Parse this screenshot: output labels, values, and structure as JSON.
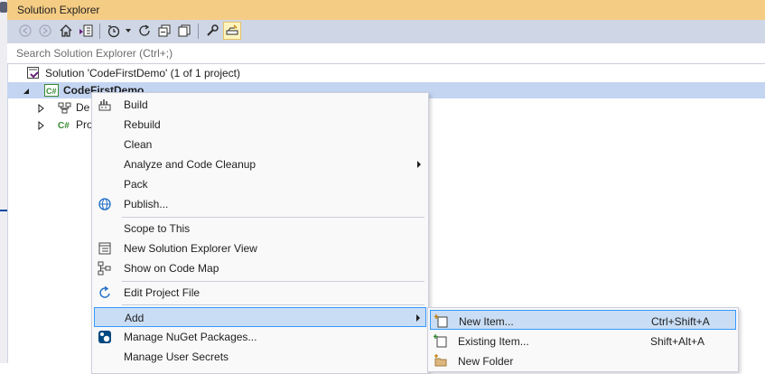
{
  "window": {
    "title": "Solution Explorer"
  },
  "toolbar": {
    "buttons": [
      "back-icon",
      "forward-icon",
      "home-icon",
      "vs-switch-views-icon",
      "pending-changes-filter-icon",
      "dropdown-arrow-icon",
      "refresh-icon",
      "collapse-all-icon",
      "show-all-files-icon",
      "properties-wrench-icon",
      "preview-selected-items-icon"
    ]
  },
  "search": {
    "placeholder": "Search Solution Explorer (Ctrl+;)"
  },
  "tree": {
    "solution": "Solution 'CodeFirstDemo' (1 of 1 project)",
    "project": "CodeFirstDemo",
    "children": [
      "De",
      "Pro"
    ]
  },
  "context_menu": {
    "items": [
      {
        "label": "Build",
        "icon": "build-icon"
      },
      {
        "label": "Rebuild"
      },
      {
        "label": "Clean"
      },
      {
        "label": "Analyze and Code Cleanup",
        "submenu": true
      },
      {
        "label": "Pack"
      },
      {
        "label": "Publish...",
        "icon": "publish-globe-icon"
      },
      {
        "label": "Scope to This"
      },
      {
        "label": "New Solution Explorer View",
        "icon": "new-explorer-view-icon"
      },
      {
        "label": "Show on Code Map",
        "icon": "code-map-icon"
      },
      {
        "label": "Edit Project File",
        "icon": "edit-project-icon"
      },
      {
        "label": "Add",
        "submenu": true,
        "highlighted": true
      },
      {
        "label": "Manage NuGet Packages...",
        "icon": "nuget-icon"
      },
      {
        "label": "Manage User Secrets"
      }
    ]
  },
  "add_submenu": {
    "items": [
      {
        "label": "New Item...",
        "shortcut": "Ctrl+Shift+A",
        "icon": "new-item-icon",
        "highlighted": true
      },
      {
        "label": "Existing Item...",
        "shortcut": "Shift+Alt+A",
        "icon": "existing-item-icon"
      },
      {
        "label": "New Folder",
        "icon": "new-folder-icon"
      }
    ]
  },
  "colors": {
    "title_bar": "#f5cc84",
    "toolbar": "#cfd6e5",
    "selection": "#c4d5f2",
    "menu_highlight": "#c9def5",
    "menu_border": "#3399ff"
  }
}
